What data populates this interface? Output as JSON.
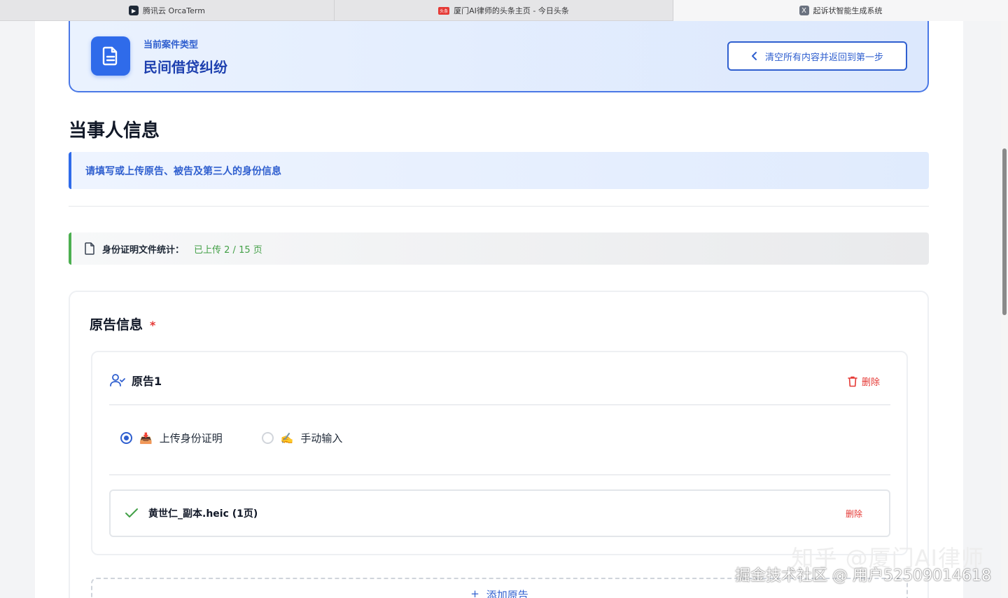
{
  "tabs": [
    {
      "label": "腾讯云 OrcaTerm",
      "icon": "orcaterm-icon"
    },
    {
      "label": "厦门AI律师的头条主页 - 今日头条",
      "icon": "toutiao-icon",
      "icon_text": "头条"
    },
    {
      "label": "起诉状智能生成系统",
      "icon": "x-icon",
      "icon_text": "X"
    }
  ],
  "case": {
    "label": "当前案件类型",
    "value": "民间借贷纠纷",
    "reset_button": "清空所有内容并返回到第一步"
  },
  "section_title": "当事人信息",
  "info_text": "请填写或上传原告、被告及第三人的身份信息",
  "stats": {
    "label": "身份证明文件统计：",
    "value": "已上传 2 / 15 页"
  },
  "plaintiff_section": {
    "title": "原告信息",
    "required_mark": "*",
    "plaintiff": {
      "name": "原告1",
      "delete_label": "删除",
      "options": [
        {
          "label": "上传身份证明",
          "emoji": "📥",
          "selected": true
        },
        {
          "label": "手动输入",
          "emoji": "✍️",
          "selected": false
        }
      ],
      "file": {
        "name": "黄世仁_副本.heic (1页)",
        "delete_label": "删除"
      }
    },
    "add_button": "添加原告",
    "add_symbol": "+"
  },
  "watermark": {
    "line1": "知乎 @厦门AI律师",
    "line2": "掘金技术社区 @ 用户52509014618"
  },
  "colors": {
    "primary": "#2f6bea",
    "danger": "#e53935",
    "success": "#43a047"
  }
}
